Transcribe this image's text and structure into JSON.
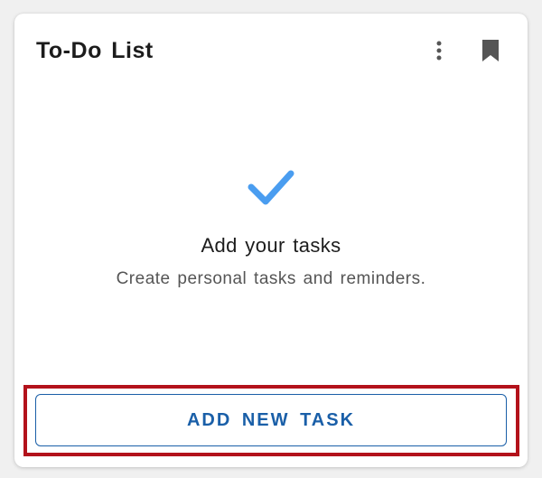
{
  "card": {
    "title": "To-Do List",
    "icons": {
      "more": "more-vertical-icon",
      "bookmark": "bookmark-icon"
    }
  },
  "empty_state": {
    "icon": "check-icon",
    "title": "Add your tasks",
    "subtitle": "Create personal tasks and reminders."
  },
  "actions": {
    "add_label": "ADD NEW TASK"
  },
  "colors": {
    "accent": "#1a5fa8",
    "check": "#4a9df0",
    "highlight": "#b3121b",
    "icon": "#555555"
  }
}
